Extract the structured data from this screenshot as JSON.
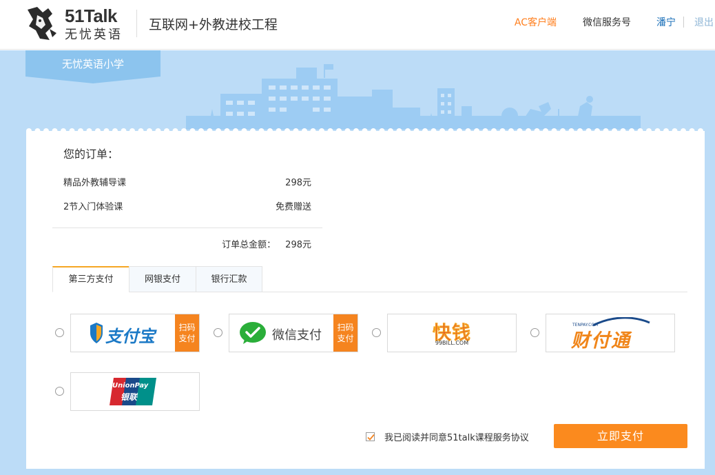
{
  "header": {
    "logo_en": "51Talk",
    "logo_cn": "无忧英语",
    "title": "互联网+外教进校工程",
    "nav_ac": "AC客户端",
    "nav_wechat": "微信服务号",
    "nav_user": "潘宁",
    "nav_logout": "退出"
  },
  "banner": {
    "school_tab": "无忧英语小学"
  },
  "order": {
    "title": "您的订单：",
    "items": [
      {
        "name": "精品外教辅导课",
        "price": "298元"
      },
      {
        "name": "2节入门体验课",
        "price": "免费赠送"
      }
    ],
    "total_label": "订单总金额：",
    "total_value": "298元"
  },
  "payment": {
    "tabs": [
      "第三方支付",
      "网银支付",
      "银行汇款"
    ],
    "active_tab": 0,
    "methods": [
      {
        "name": "支付宝",
        "badge": [
          "扫码",
          "支付"
        ]
      },
      {
        "name": "微信支付",
        "badge": [
          "扫码",
          "支付"
        ]
      },
      {
        "name": "快钱",
        "sub": "99BILL.COM"
      },
      {
        "name": "财付通",
        "sub": "TENPAY.COM"
      },
      {
        "name": "UnionPay",
        "sub": "银联"
      }
    ]
  },
  "agreement": {
    "text": "我已阅读并同意51talk课程服务协议",
    "checked": true
  },
  "submit": "立即支付",
  "colors": {
    "accent_orange": "#fb8a1e",
    "banner_blue": "#bcdcf7",
    "link_blue": "#1a6fb8"
  }
}
